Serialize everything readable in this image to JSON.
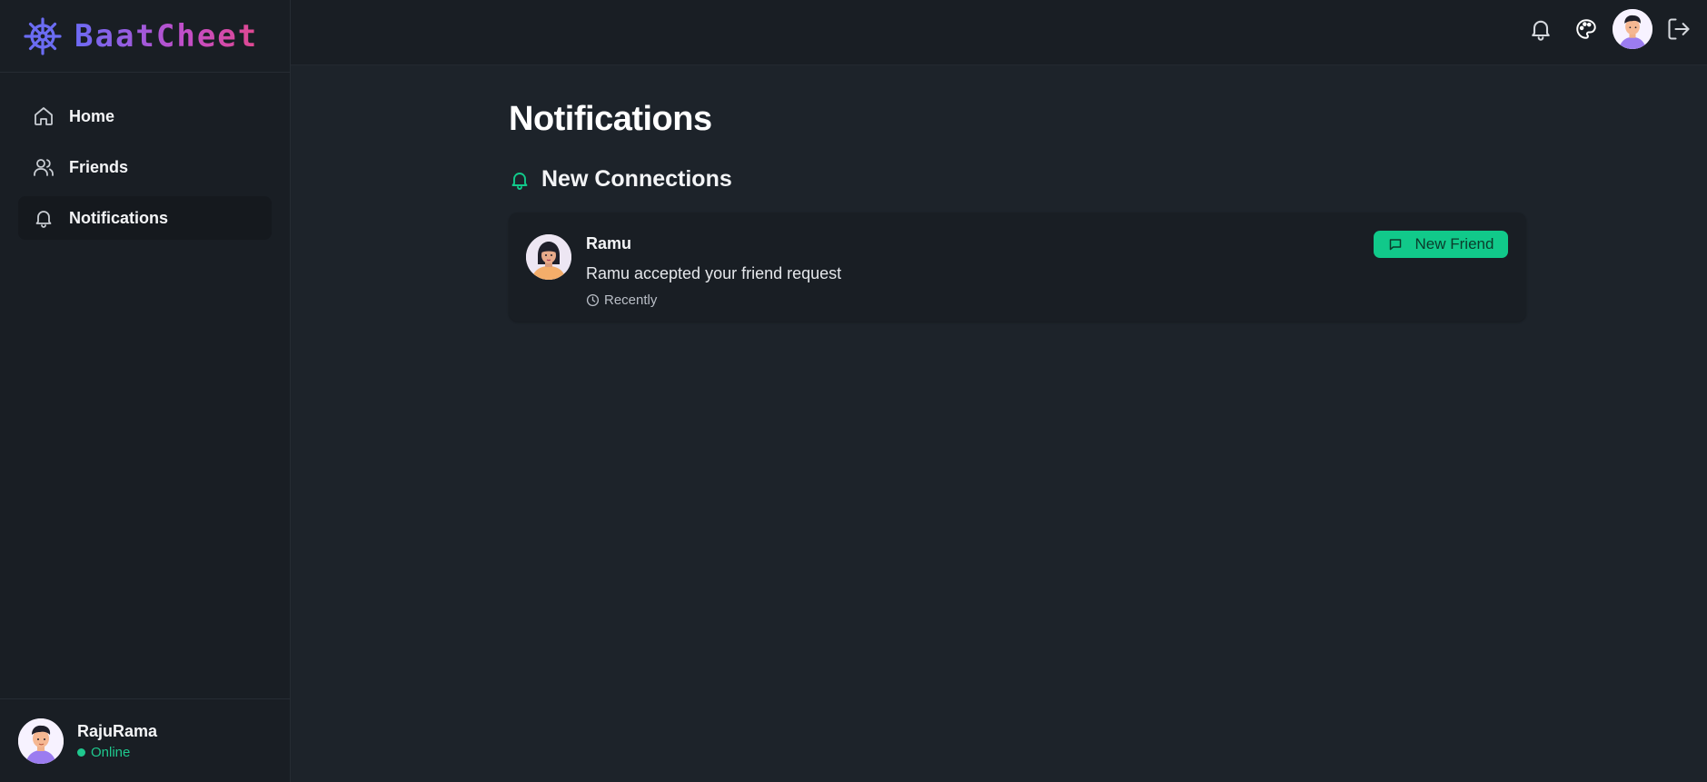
{
  "app": {
    "name": "BaatCheet"
  },
  "sidebar": {
    "items": [
      {
        "label": "Home",
        "icon": "home-icon"
      },
      {
        "label": "Friends",
        "icon": "users-icon"
      },
      {
        "label": "Notifications",
        "icon": "bell-icon",
        "active": true
      }
    ],
    "user": {
      "name": "RajuRama",
      "status": "Online"
    }
  },
  "topbar": {
    "icons": [
      "bell-icon",
      "palette-icon",
      "avatar",
      "logout-icon"
    ]
  },
  "main": {
    "title": "Notifications",
    "section_title": "New Connections",
    "notifications": [
      {
        "name": "Ramu",
        "message": "Ramu accepted your friend request",
        "time": "Recently",
        "badge": "New Friend"
      }
    ]
  },
  "colors": {
    "background": "#1d232a",
    "panel": "#191e24",
    "accent_green": "#11c98a",
    "brand_start": "#6d6bf5",
    "brand_end": "#e0488f"
  }
}
